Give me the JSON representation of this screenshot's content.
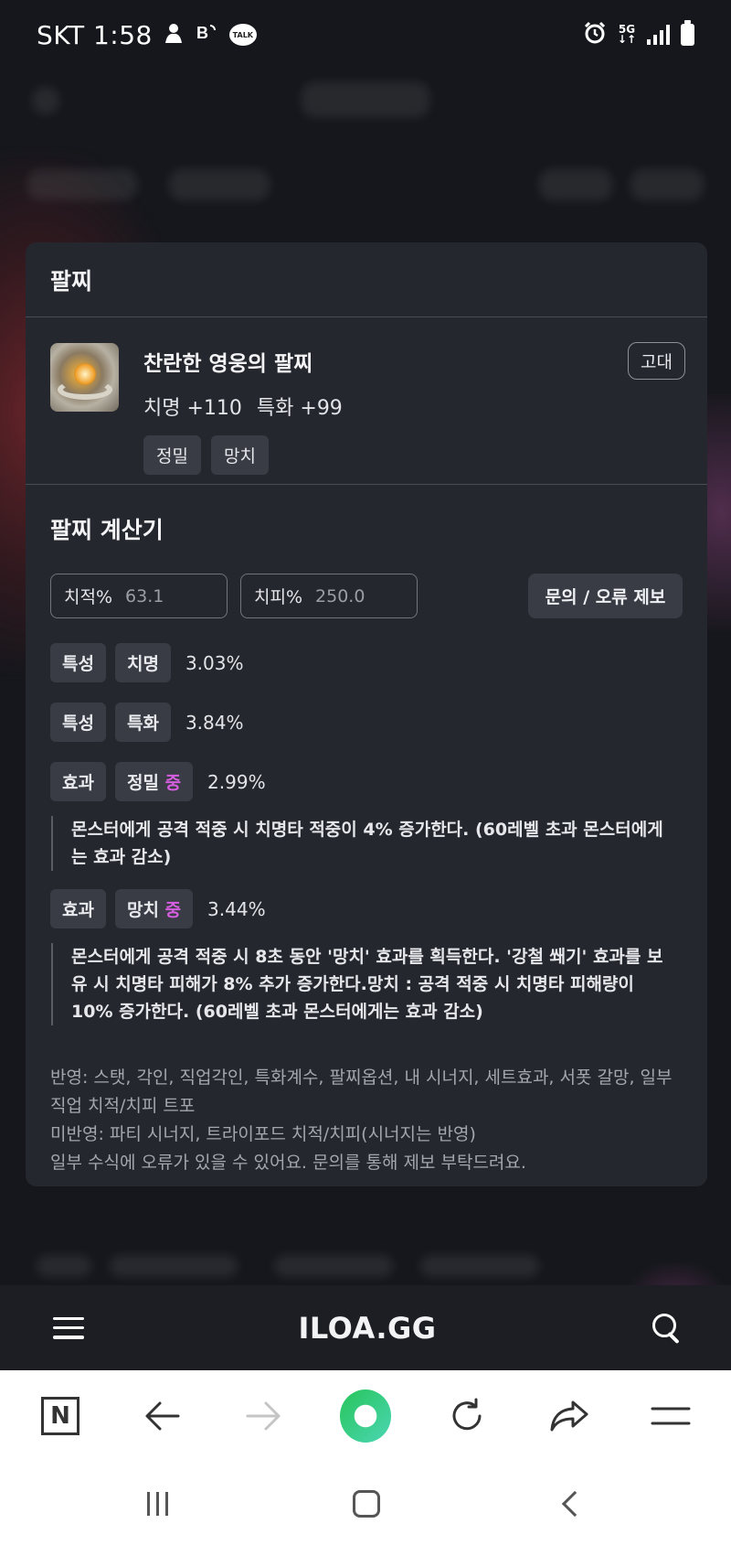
{
  "status_bar": {
    "carrier_time": "SKT 1:58",
    "talk_label": "TALK",
    "network_label": "5G"
  },
  "modal": {
    "title": "팔찌",
    "item": {
      "name": "찬란한 영웅의 팔찌",
      "stats": [
        "치명 +110",
        "특화 +99"
      ],
      "tags": [
        "정밀",
        "망치"
      ],
      "grade": "고대"
    },
    "calculator": {
      "title": "팔찌 계산기",
      "crit_rate": {
        "label": "치적%",
        "value": "63.1"
      },
      "crit_damage": {
        "label": "치피%",
        "value": "250.0"
      },
      "report_button": "문의 / 오류 제보",
      "results": [
        {
          "category": "특성",
          "name": "치명",
          "grade": "",
          "value": "3.03%",
          "description": ""
        },
        {
          "category": "특성",
          "name": "특화",
          "grade": "",
          "value": "3.84%",
          "description": ""
        },
        {
          "category": "효과",
          "name": "정밀",
          "grade": "중",
          "value": "2.99%",
          "description": "몬스터에게 공격 적중 시 치명타 적중이 4% 증가한다. (60레벨 초과 몬스터에게는 효과 감소)"
        },
        {
          "category": "효과",
          "name": "망치",
          "grade": "중",
          "value": "3.44%",
          "description": "몬스터에게 공격 적중 시 8초 동안 '망치' 효과를 획득한다. '강철 쐐기' 효과를 보유 시 치명타 피해가 8% 추가 증가한다.망치 : 공격 적중 시 치명타 피해량이 10% 증가한다. (60레벨 초과 몬스터에게는 효과 감소)"
        }
      ],
      "notes": [
        "반영: 스탯, 각인, 직업각인, 특화계수, 팔찌옵션, 내 시너지, 세트효과, 서폿 갈망, 일부 직업 치적/치피 트포",
        "미반영: 파티 시너지, 트라이포드 치적/치피(시너지는 반영)",
        "일부 수식에 오류가 있을 수 있어요. 문의를 통해 제보 부탁드려요."
      ]
    }
  },
  "site_bar": {
    "logo": "ILOA.GG",
    "menu_icon": "hamburger-menu-icon",
    "search_icon": "search-icon"
  },
  "browser_bar": {
    "items": [
      "n-home-icon",
      "back-arrow-icon",
      "forward-arrow-icon",
      "green-dot-icon",
      "refresh-icon",
      "share-icon",
      "menu-icon"
    ]
  },
  "colors": {
    "page_bg": "#16171c",
    "modal_bg": "#25272e",
    "pill_bg": "#3a3c45",
    "accent_grade": "#d65ee0",
    "muted_text": "#a4a6ae"
  }
}
